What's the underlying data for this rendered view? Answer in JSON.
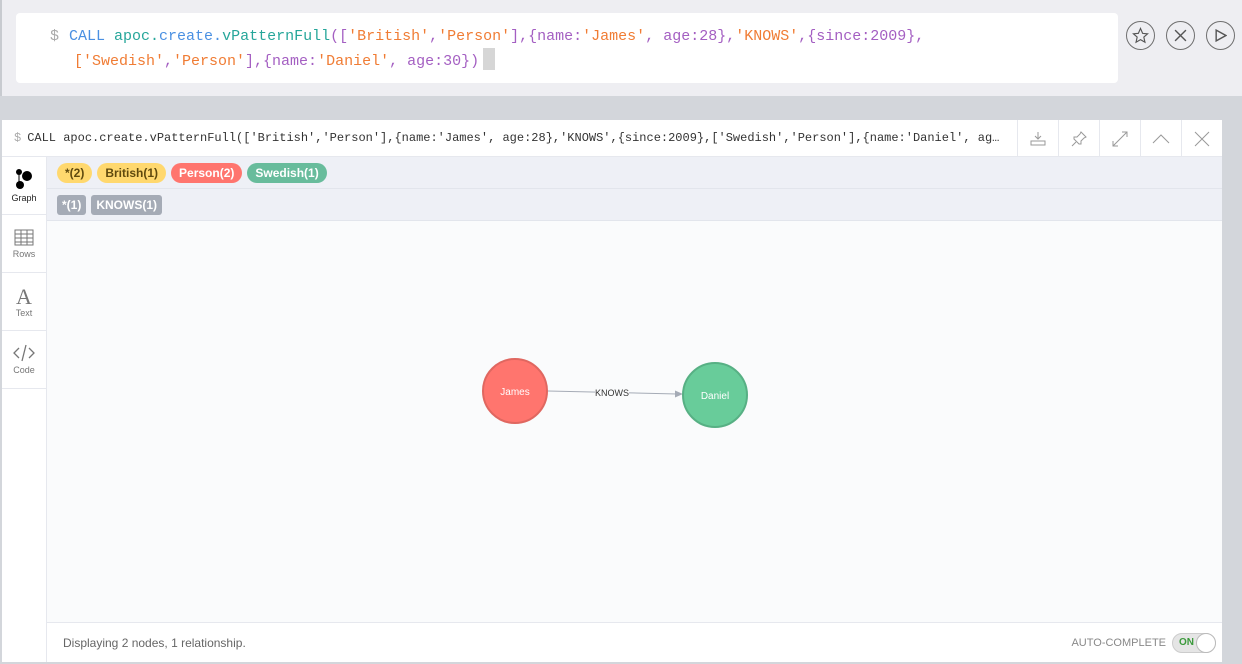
{
  "editor": {
    "prompt": "$",
    "line1": [
      {
        "t": "CALL ",
        "c": "kw"
      },
      {
        "t": "apoc.",
        "c": "fn"
      },
      {
        "t": "create.",
        "c": "fn2"
      },
      {
        "t": "vPatternFull",
        "c": "fn"
      },
      {
        "t": "([",
        "c": "pn"
      },
      {
        "t": "'British'",
        "c": "str"
      },
      {
        "t": ",",
        "c": "pn"
      },
      {
        "t": "'Person'",
        "c": "str"
      },
      {
        "t": "],{name:",
        "c": "pn"
      },
      {
        "t": "'James'",
        "c": "str"
      },
      {
        "t": ", age:28},",
        "c": "pn"
      },
      {
        "t": "'KNOWS'",
        "c": "str"
      },
      {
        "t": ",{since:2009},",
        "c": "pn"
      }
    ],
    "line2": [
      {
        "t": "['Swedish'",
        "c": "str"
      },
      {
        "t": ",",
        "c": "pn"
      },
      {
        "t": "'Person'",
        "c": "str"
      },
      {
        "t": "],{name:",
        "c": "pn"
      },
      {
        "t": "'Daniel'",
        "c": "str"
      },
      {
        "t": ", age:30})",
        "c": "pn"
      }
    ],
    "buttons": [
      "favorite-icon",
      "clear-icon",
      "run-icon"
    ]
  },
  "frame": {
    "prompt": "$",
    "query": "CALL apoc.create.vPatternFull(['British','Person'],{name:'James', age:28},'KNOWS',{since:2009},['Swedish','Person'],{name:'Daniel', ag…",
    "tools": [
      "download-icon",
      "pin-icon",
      "expand-icon",
      "collapse-icon",
      "close-icon"
    ]
  },
  "sidebar": [
    {
      "label": "Graph",
      "icon": "graph-icon"
    },
    {
      "label": "Rows",
      "icon": "table-icon"
    },
    {
      "label": "Text",
      "icon": "text-icon"
    },
    {
      "label": "Code",
      "icon": "code-icon"
    }
  ],
  "node_labels": [
    {
      "text": "*(2)",
      "bg": "#ffd86e",
      "fg": "#604a0e"
    },
    {
      "text": "British(1)",
      "bg": "#ffd86e",
      "fg": "#604a0e"
    },
    {
      "text": "Person(2)",
      "bg": "#ff756e",
      "fg": "#ffffff"
    },
    {
      "text": "Swedish(1)",
      "bg": "#68bc9c",
      "fg": "#ffffff"
    }
  ],
  "rel_types": [
    {
      "text": "*(1)"
    },
    {
      "text": "KNOWS(1)"
    }
  ],
  "graph": {
    "nodes": [
      {
        "name": "James",
        "color": "#ff756e",
        "stroke": "#e06760"
      },
      {
        "name": "Daniel",
        "color": "#68cc9a",
        "stroke": "#57b084"
      }
    ],
    "relationship": "KNOWS"
  },
  "footer": {
    "status": "Displaying 2 nodes, 1 relationship.",
    "autocomplete": "AUTO-COMPLETE",
    "toggle": "ON"
  }
}
